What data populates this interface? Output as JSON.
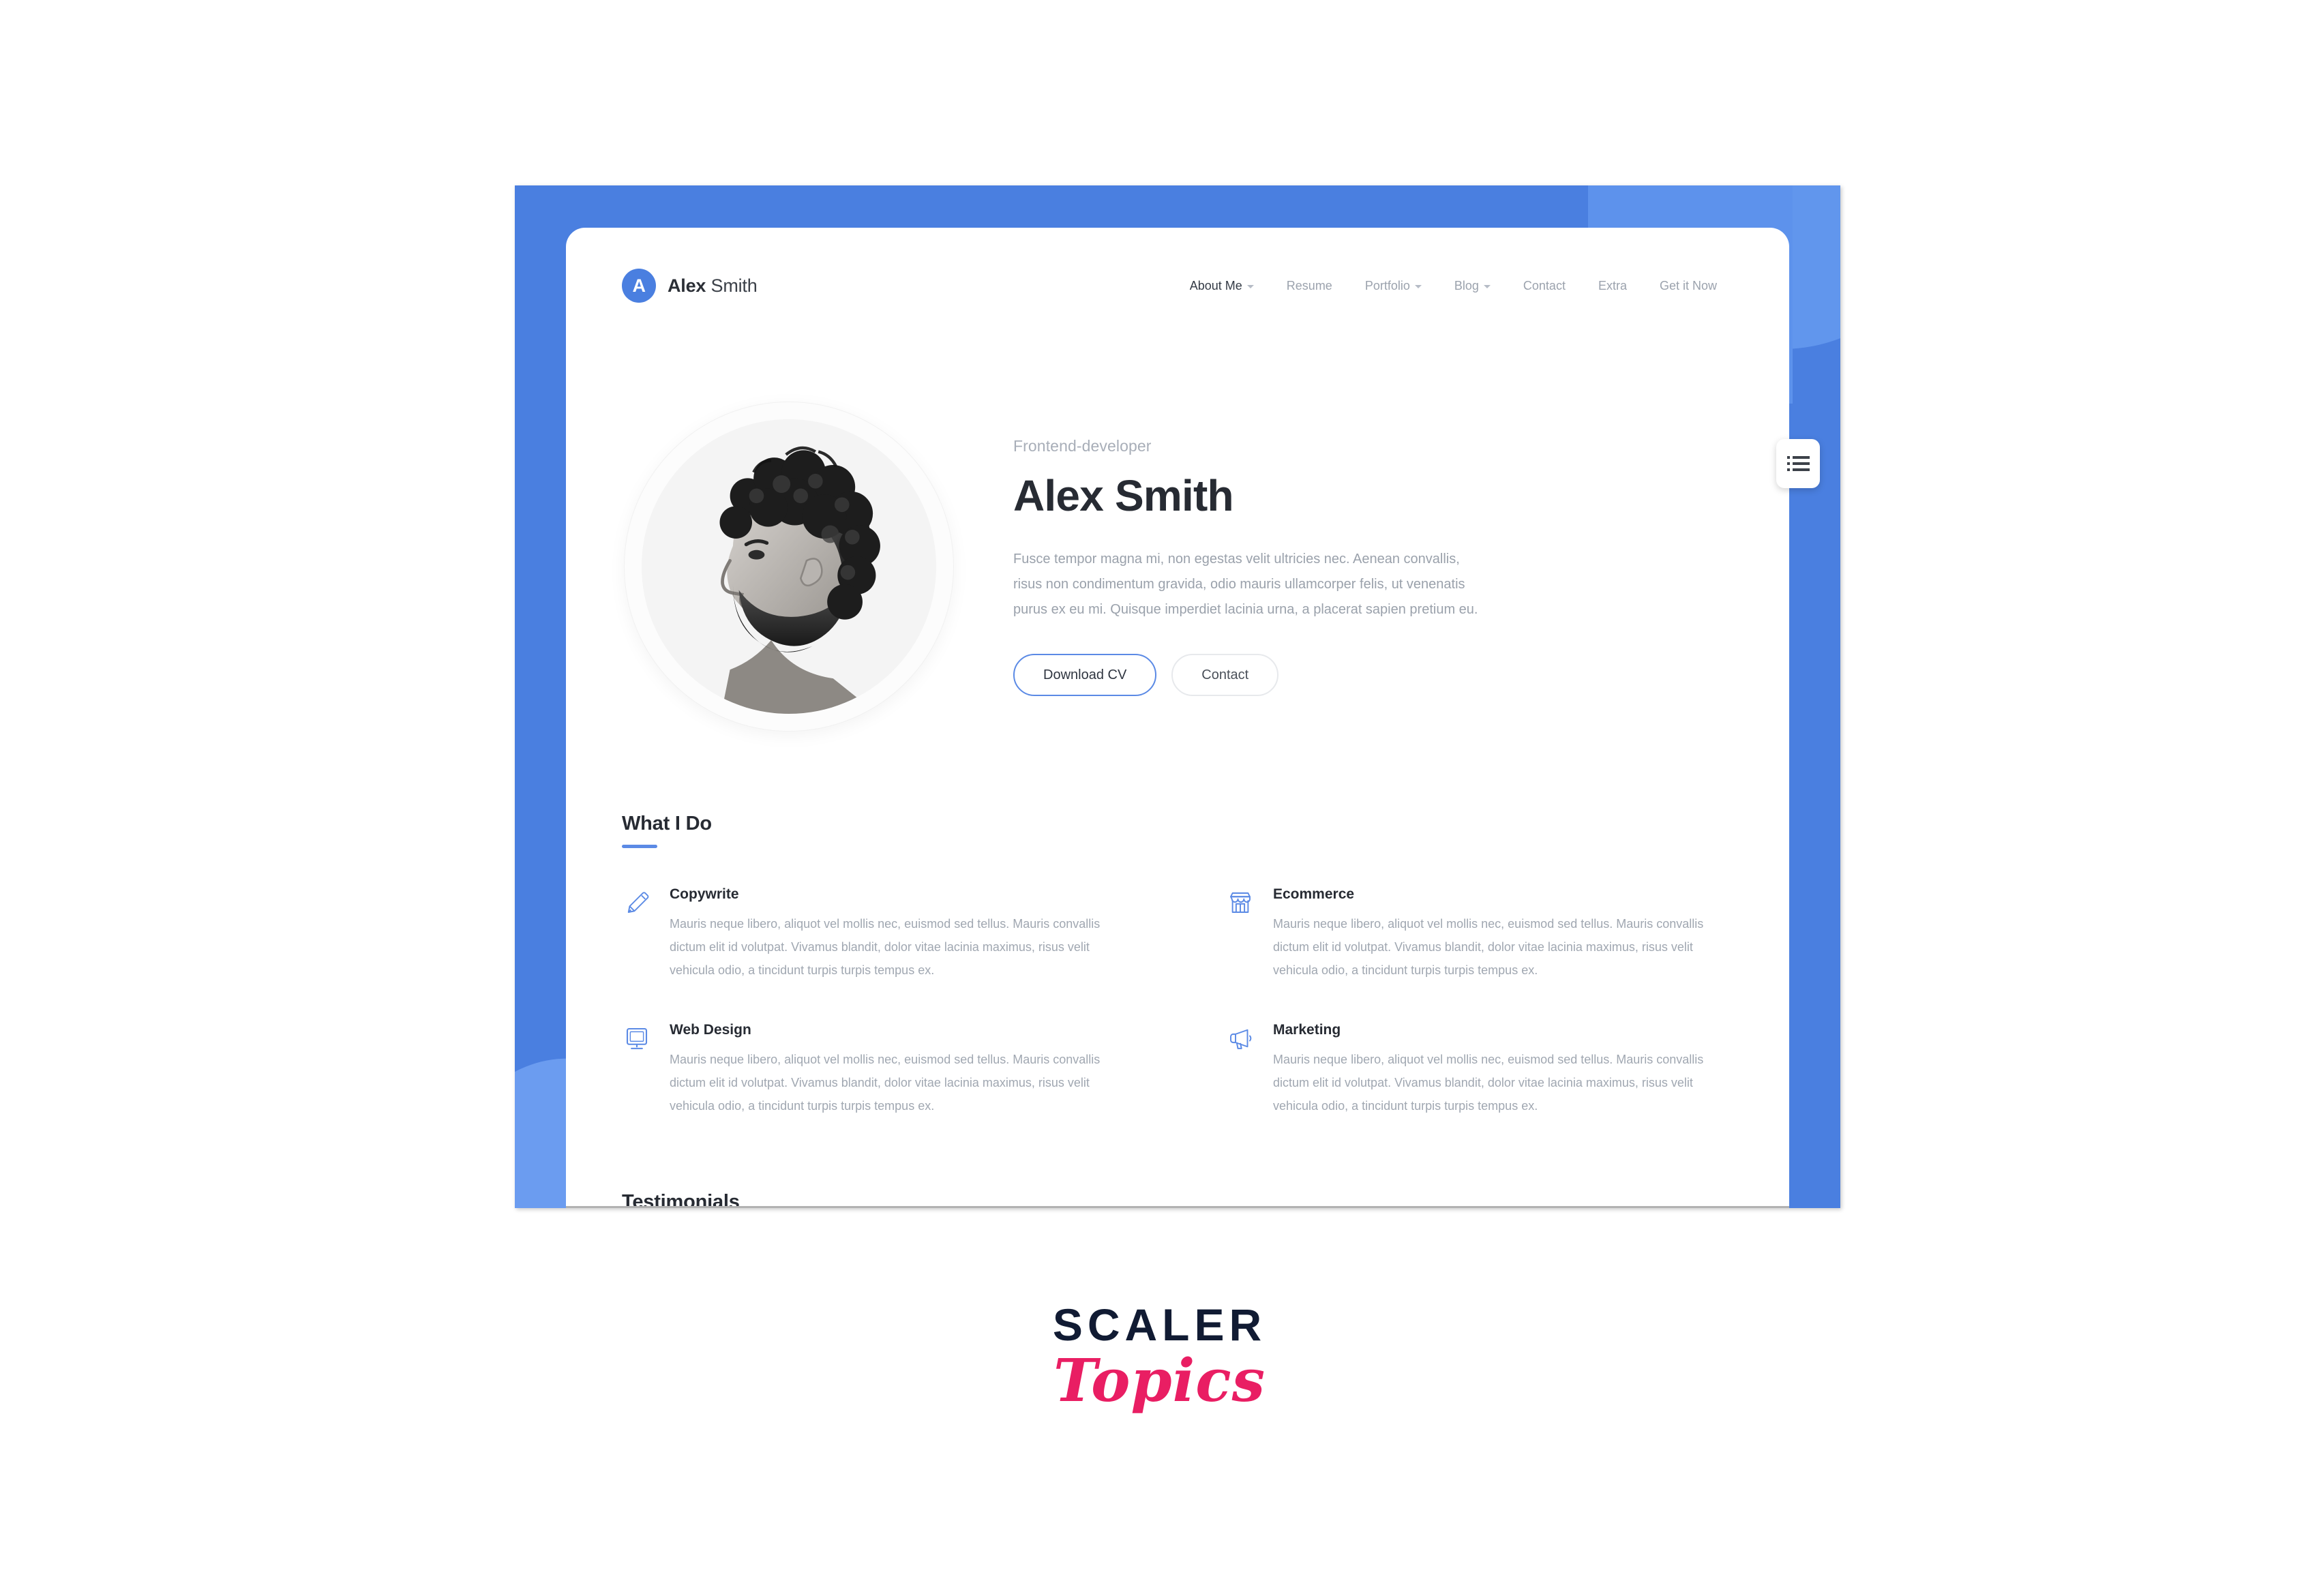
{
  "brand": {
    "badge_letter": "A",
    "name_bold": "Alex",
    "name_light": " Smith"
  },
  "nav": {
    "items": [
      {
        "label": "About Me",
        "caret": true,
        "active": true
      },
      {
        "label": "Resume",
        "caret": false,
        "active": false
      },
      {
        "label": "Portfolio",
        "caret": true,
        "active": false
      },
      {
        "label": "Blog",
        "caret": true,
        "active": false
      },
      {
        "label": "Contact",
        "caret": false,
        "active": false
      },
      {
        "label": "Extra",
        "caret": false,
        "active": false
      },
      {
        "label": "Get it Now",
        "caret": false,
        "active": false
      }
    ]
  },
  "side_tab": {
    "icon": "list-menu-icon"
  },
  "hero": {
    "eyebrow": "Frontend-developer",
    "title": "Alex Smith",
    "description": "Fusce tempor magna mi, non egestas velit ultricies nec. Aenean convallis, risus non condimentum gravida, odio mauris ullamcorper felis, ut venenatis purus ex eu mi. Quisque imperdiet lacinia urna, a placerat sapien pretium eu.",
    "primary_button": "Download CV",
    "secondary_button": "Contact",
    "portrait_alt": "profile-portrait-black-and-white"
  },
  "what_i_do": {
    "title": "What I Do",
    "services": [
      {
        "name": "Copywrite",
        "icon": "pencil-icon",
        "desc": "Mauris neque libero, aliquot vel mollis nec, euismod sed tellus. Mauris convallis dictum elit id volutpat. Vivamus blandit, dolor vitae lacinia maximus, risus velit vehicula odio, a tincidunt turpis turpis tempus ex."
      },
      {
        "name": "Ecommerce",
        "icon": "shop-icon",
        "desc": "Mauris neque libero, aliquot vel mollis nec, euismod sed tellus. Mauris convallis dictum elit id volutpat. Vivamus blandit, dolor vitae lacinia maximus, risus velit vehicula odio, a tincidunt turpis turpis tempus ex."
      },
      {
        "name": "Web Design",
        "icon": "monitor-icon",
        "desc": "Mauris neque libero, aliquot vel mollis nec, euismod sed tellus. Mauris convallis dictum elit id volutpat. Vivamus blandit, dolor vitae lacinia maximus, risus velit vehicula odio, a tincidunt turpis turpis tempus ex."
      },
      {
        "name": "Marketing",
        "icon": "megaphone-icon",
        "desc": "Mauris neque libero, aliquot vel mollis nec, euismod sed tellus. Mauris convallis dictum elit id volutpat. Vivamus blandit, dolor vitae lacinia maximus, risus velit vehicula odio, a tincidunt turpis turpis tempus ex."
      }
    ]
  },
  "testimonials": {
    "title": "Testimonials"
  },
  "watermark": {
    "line1": "SCALER",
    "line2": "Topics"
  },
  "colors": {
    "brand_blue": "#4a7fe0",
    "accent_blue": "#5b8ae5",
    "heading_dark": "#272b33",
    "body_gray": "#a0a7b1",
    "watermark_navy": "#111b33",
    "watermark_pink": "#e91e63"
  }
}
